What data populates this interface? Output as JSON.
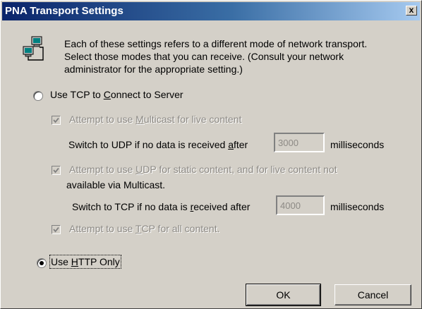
{
  "window": {
    "title": "PNA Transport Settings",
    "close_glyph": "x"
  },
  "info": {
    "icon": "network-computer-icon",
    "text": "Each of these settings refers to a different mode of network transport. Select those modes that you can receive. (Consult your network administrator for the appropriate setting.)"
  },
  "tcp_option": {
    "pre": "Use TCP to ",
    "key": "C",
    "post": "onnect to Server",
    "selected": false
  },
  "multicast": {
    "pre": "Attempt to use ",
    "key": "M",
    "post": "ulticast for live content",
    "checked": true,
    "enabled": false
  },
  "udp_switch": {
    "pre": "Switch to UDP if no data is received ",
    "key": "a",
    "post": "fter",
    "value": "3000",
    "unit": "milliseconds"
  },
  "udp": {
    "pre": "Attempt to use ",
    "key": "U",
    "post": "DP for static content, and for live content not",
    "line2": "available via Multicast.",
    "checked": true,
    "enabled": false
  },
  "tcp_switch": {
    "pre": "Switch to TCP if no data is ",
    "key": "r",
    "post": "eceived after",
    "value": "4000",
    "unit": "milliseconds"
  },
  "tcp_all": {
    "pre": "Attempt to use ",
    "key": "T",
    "post": "CP for all content.",
    "checked": true,
    "enabled": false
  },
  "http_option": {
    "pre": "Use ",
    "key": "H",
    "post": "TTP Only",
    "selected": true
  },
  "buttons": {
    "ok": "OK",
    "cancel": "Cancel"
  },
  "colors": {
    "face": "#d4d0c8",
    "title_start": "#0a246a",
    "title_end": "#a6caf0",
    "disabled_text": "#8d8a85"
  }
}
